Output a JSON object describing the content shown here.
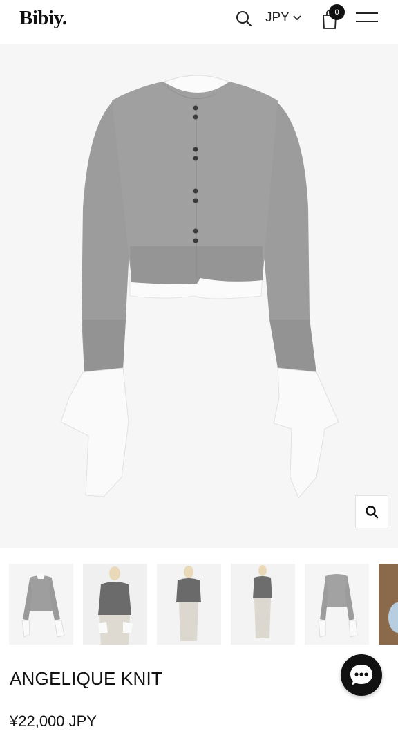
{
  "header": {
    "logo": "Bibiy.",
    "currency": "JPY",
    "cart_count": "0",
    "search_icon": "search-icon",
    "menu_icon": "hamburger-menu-icon",
    "cart_icon": "shopping-bag-icon"
  },
  "gallery": {
    "main_image_alt": "Grey cropped knit cardigan with white shirt layer and cuff ribbons",
    "zoom_icon": "magnifier-zoom-icon",
    "thumbnails": [
      {
        "name": "thumb-front-flat"
      },
      {
        "name": "thumb-model-front"
      },
      {
        "name": "thumb-model-back"
      },
      {
        "name": "thumb-model-full"
      },
      {
        "name": "thumb-back-flat"
      },
      {
        "name": "thumb-detail"
      }
    ]
  },
  "product": {
    "title": "ANGELIQUE KNIT",
    "price": "¥22,000 JPY"
  },
  "chat": {
    "icon": "chat-bubble-icon"
  },
  "colors": {
    "brand_text": "#111111",
    "knit_grey": "#9a9a9a",
    "background": "#f6f6f6"
  }
}
